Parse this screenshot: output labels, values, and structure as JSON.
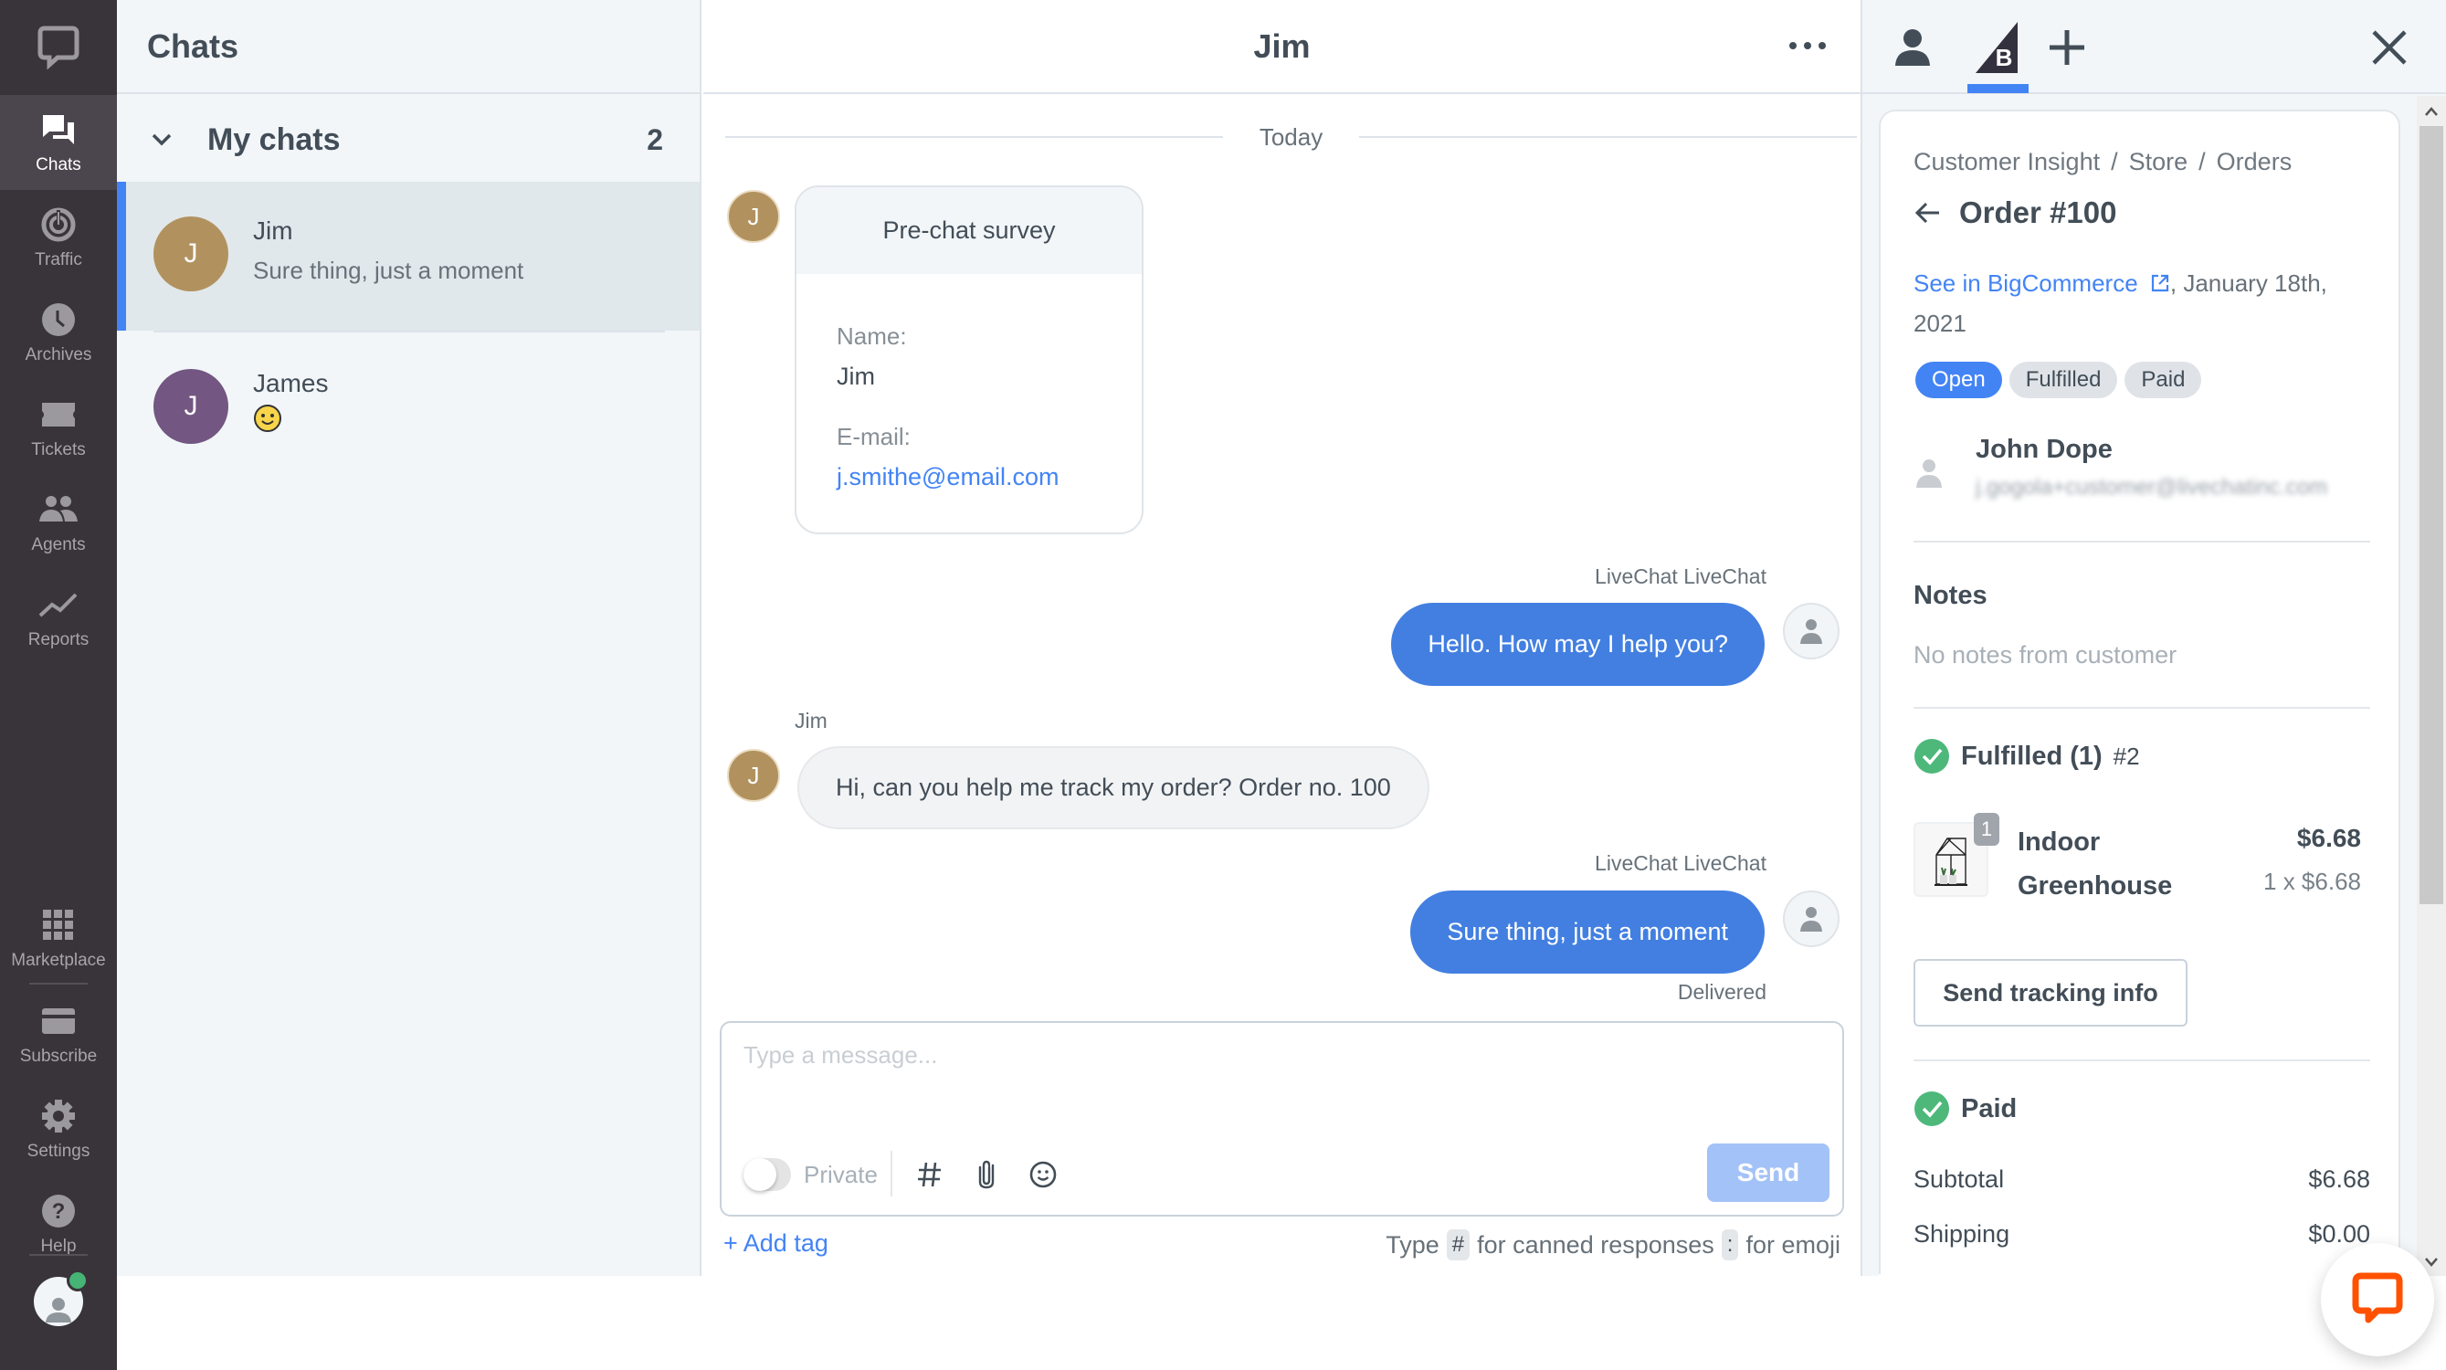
{
  "sidebar": {
    "logo": "livechat-logo",
    "items": [
      {
        "label": "Chats",
        "icon": "chats-icon",
        "active": true
      },
      {
        "label": "Traffic",
        "icon": "traffic-icon"
      },
      {
        "label": "Archives",
        "icon": "archives-icon"
      },
      {
        "label": "Tickets",
        "icon": "tickets-icon"
      },
      {
        "label": "Agents",
        "icon": "agents-icon"
      },
      {
        "label": "Reports",
        "icon": "reports-icon"
      }
    ],
    "bottom_items": [
      {
        "label": "Marketplace",
        "icon": "marketplace-icon"
      },
      {
        "label": "Subscribe",
        "icon": "subscribe-icon"
      },
      {
        "label": "Settings",
        "icon": "settings-icon"
      },
      {
        "label": "Help",
        "icon": "help-icon"
      }
    ],
    "user_status": "online",
    "colors": {
      "background": "#38343a",
      "active": "#4b464e",
      "status": "#46b474"
    }
  },
  "chat_list": {
    "title": "Chats",
    "group": {
      "label": "My chats",
      "count": "2"
    },
    "chats": [
      {
        "initial": "J",
        "name": "Jim",
        "preview": "Sure thing, just a moment",
        "avatar_color": "#b1925f",
        "selected": true
      },
      {
        "initial": "J",
        "name": "James",
        "preview": "🙂",
        "avatar_color": "#735681",
        "selected": false
      }
    ]
  },
  "chat": {
    "title": "Jim",
    "date_divider": "Today",
    "survey": {
      "title": "Pre-chat survey",
      "name_label": "Name:",
      "name_value": "Jim",
      "email_label": "E-mail:",
      "email_value": "j.smithe@email.com"
    },
    "messages": [
      {
        "author": "LiveChat LiveChat",
        "text": "Hello. How may I help you?",
        "direction": "out"
      },
      {
        "author": "Jim",
        "initial": "J",
        "text": "Hi, can you help me track my order? Order no. 100",
        "direction": "in"
      },
      {
        "author": "LiveChat LiveChat",
        "text": "Sure thing, just a moment",
        "direction": "out",
        "status": "Delivered"
      }
    ],
    "composer": {
      "placeholder": "Type a message...",
      "value": "",
      "private_label": "Private",
      "private_on": false,
      "send_label": "Send"
    },
    "add_tag": "+ Add tag",
    "hint": {
      "prefix": "Type",
      "key1": "#",
      "mid": "for canned responses",
      "key2": ":",
      "suffix": "for emoji"
    },
    "colors": {
      "outgoing_bubble": "#427fe1",
      "incoming_bubble": "#f2f3f5",
      "send_disabled": "#a3c2f7",
      "link": "#4384f5"
    }
  },
  "details": {
    "tabs": [
      {
        "icon": "customer-icon"
      },
      {
        "icon": "bigcommerce-icon",
        "active": true
      },
      {
        "icon": "add-app-icon"
      }
    ],
    "breadcrumb": [
      "Customer Insight",
      "Store",
      "Orders"
    ],
    "order_title": "Order #100",
    "see_in_link": "See in BigCommerce",
    "date": ", January 18th, 2021",
    "statuses": [
      "Open",
      "Fulfilled",
      "Paid"
    ],
    "customer": {
      "name": "John Dope",
      "email": "j.gogola+customer@livechatinc.com"
    },
    "notes": {
      "title": "Notes",
      "empty": "No notes from customer"
    },
    "fulfilled": {
      "title": "Fulfilled (1)",
      "number": "#2"
    },
    "items": [
      {
        "qty_badge": "1",
        "name": "Indoor Greenhouse",
        "price": "$6.68",
        "qty_price": "1 x $6.68"
      }
    ],
    "send_tracking": "Send tracking info",
    "paid": {
      "title": "Paid"
    },
    "summary": [
      {
        "label": "Subtotal",
        "value": "$6.68"
      },
      {
        "label": "Shipping",
        "value": "$0.00"
      }
    ]
  },
  "widget": {
    "icon": "livechat-widget-icon",
    "color": "#ff5100"
  }
}
